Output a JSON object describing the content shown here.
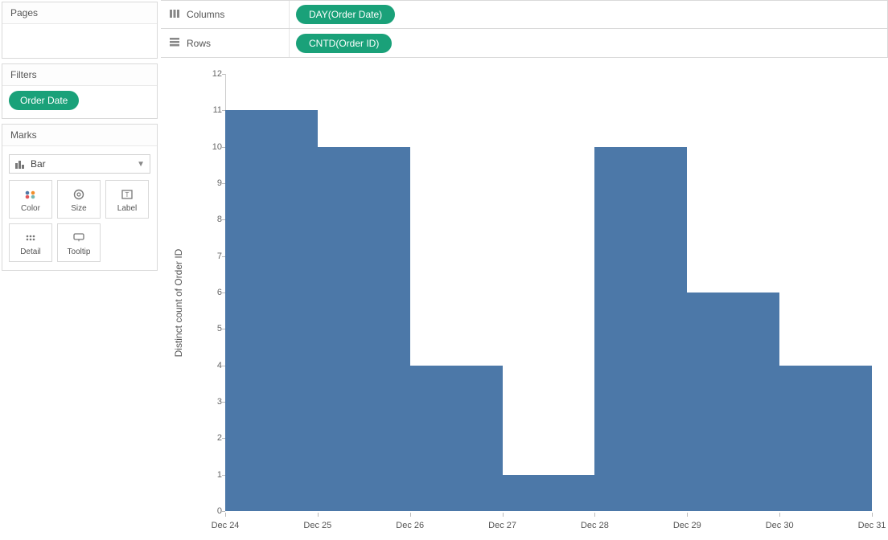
{
  "sidebar": {
    "pages_title": "Pages",
    "filters_title": "Filters",
    "filters": {
      "pill": "Order Date"
    },
    "marks_title": "Marks",
    "marks_type": "Bar",
    "mark_buttons": {
      "color": "Color",
      "size": "Size",
      "label": "Label",
      "detail": "Detail",
      "tooltip": "Tooltip"
    }
  },
  "shelves": {
    "columns_label": "Columns",
    "columns_pill": "DAY(Order Date)",
    "rows_label": "Rows",
    "rows_pill": "CNTD(Order ID)"
  },
  "chart_data": {
    "type": "bar",
    "categories": [
      "Dec 24",
      "Dec 25",
      "Dec 26",
      "Dec 27",
      "Dec 28",
      "Dec 29",
      "Dec 30",
      "Dec 31"
    ],
    "values": [
      11,
      10,
      4,
      1,
      10,
      6,
      4
    ],
    "ylabel": "Distinct count of Order ID",
    "xlabel": "",
    "ylim": [
      0,
      12
    ],
    "y_ticks": [
      0,
      1,
      2,
      3,
      4,
      5,
      6,
      7,
      8,
      9,
      10,
      11,
      12
    ],
    "bar_color": "#4c78a8"
  }
}
